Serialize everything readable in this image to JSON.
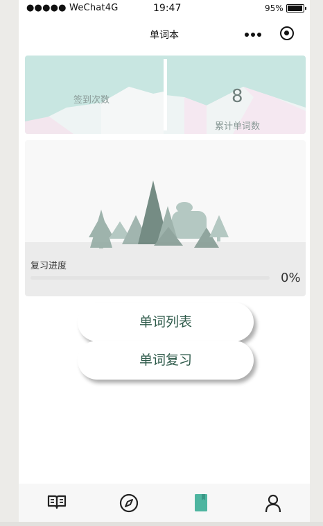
{
  "status_bar": {
    "carrier": "●●●●● WeChat4G",
    "time": "19:47",
    "battery": "95%",
    "battery_level": 0.95
  },
  "nav": {
    "title": "单词本",
    "icons": [
      "more-icon",
      "target-icon"
    ]
  },
  "stats": {
    "checkin_label": "签到次数",
    "words_value": "8",
    "words_label": "累计单词数"
  },
  "review": {
    "label": "复习进度",
    "percent_text": "0%",
    "progress": 0
  },
  "buttons": {
    "word_list": "单词列表",
    "word_review": "单词复习"
  },
  "tabbar": {
    "items": [
      {
        "icon": "book-icon",
        "active": false
      },
      {
        "icon": "compass-icon",
        "active": false
      },
      {
        "icon": "notebook-icon",
        "active": true
      },
      {
        "icon": "user-icon",
        "active": false
      }
    ],
    "active_color": "#4eb5a0"
  },
  "colors": {
    "accent": "#4eb5a0",
    "stats_bg": "#c8e6e1",
    "button_text": "#2e5a4a"
  }
}
